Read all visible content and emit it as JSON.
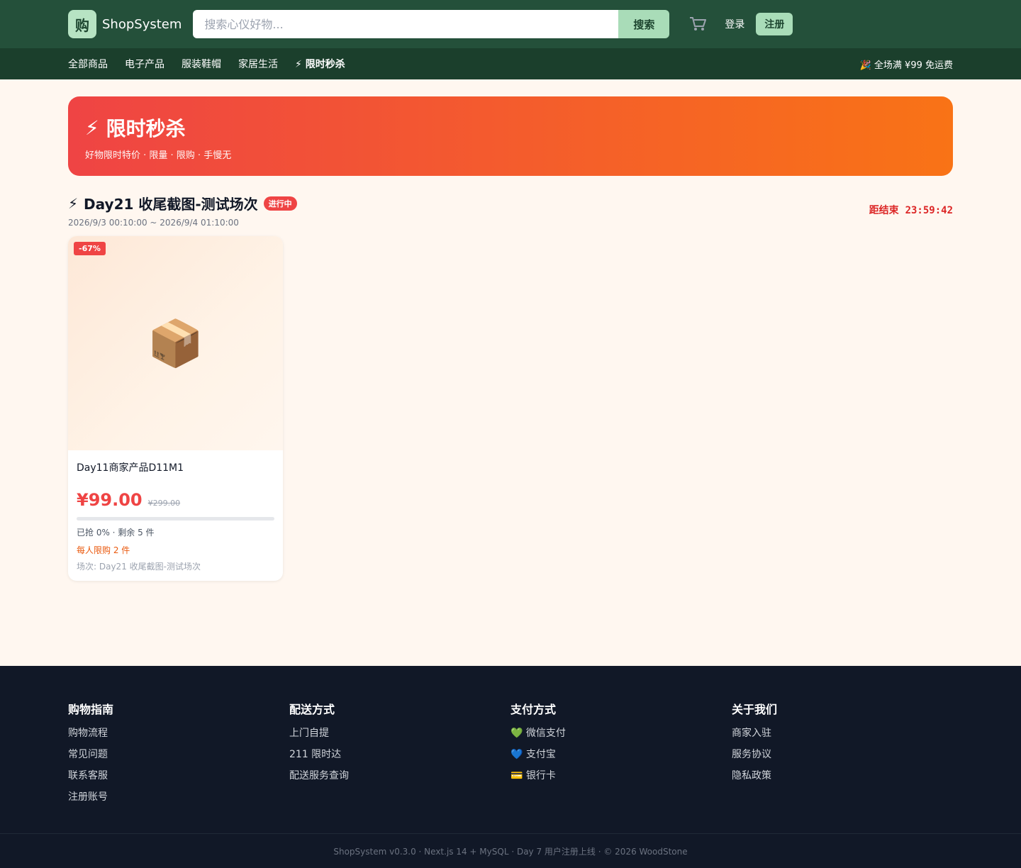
{
  "header": {
    "logo_char": "购",
    "brand": "ShopSystem",
    "search_placeholder": "搜索心仪好物...",
    "search_button": "搜索",
    "login": "登录",
    "register": "注册"
  },
  "nav": {
    "items": [
      {
        "label": "全部商品"
      },
      {
        "label": "电子产品"
      },
      {
        "label": "服装鞋帽"
      },
      {
        "label": "家居生活"
      },
      {
        "label": "⚡ 限时秒杀"
      }
    ],
    "promo": "🎉 全场满 ¥99 免运费"
  },
  "hero": {
    "icon": "⚡",
    "title": "限时秒杀",
    "subtitle": "好物限时特价 · 限量 · 限购 · 手慢无"
  },
  "session": {
    "icon": "⚡",
    "title": "Day21 收尾截图-测试场次",
    "status": "进行中",
    "time_range": "2026/9/3 00:10:00 ~ 2026/9/4 01:10:00",
    "countdown_label": "距结束",
    "countdown": "23:59:42"
  },
  "products": [
    {
      "discount": "-67%",
      "image_emoji": "📦",
      "name": "Day11商家产品D11M1",
      "price": "¥99.00",
      "original_price": "¥299.00",
      "sold_fraction": 0,
      "sold_text": "已抢 0% · 剩余 5 件",
      "limit": "每人限购 2 件",
      "session": "场次: Day21 收尾截图-测试场次"
    }
  ],
  "footer": {
    "cols": [
      {
        "title": "购物指南",
        "links": [
          "购物流程",
          "常见问题",
          "联系客服",
          "注册账号"
        ]
      },
      {
        "title": "配送方式",
        "links": [
          "上门自提",
          "211 限时达",
          "配送服务查询"
        ]
      },
      {
        "title": "支付方式",
        "links": [
          "💚 微信支付",
          "💙 支付宝",
          "💳 银行卡"
        ]
      },
      {
        "title": "关于我们",
        "links": [
          "商家入驻",
          "服务协议",
          "隐私政策"
        ]
      }
    ],
    "copyright": "ShopSystem v0.3.0 · Next.js 14 + MySQL · Day 7 用户注册上线 · © 2026 WoodStone"
  },
  "colors": {
    "header_bg": "#24503a",
    "subnav_bg": "#1b3f2c",
    "accent_green": "#a9dcb8",
    "sale_red": "#ef4444",
    "sale_orange": "#f97316",
    "footer_bg": "#111827"
  },
  "icons": {
    "cart": "cart-icon"
  }
}
